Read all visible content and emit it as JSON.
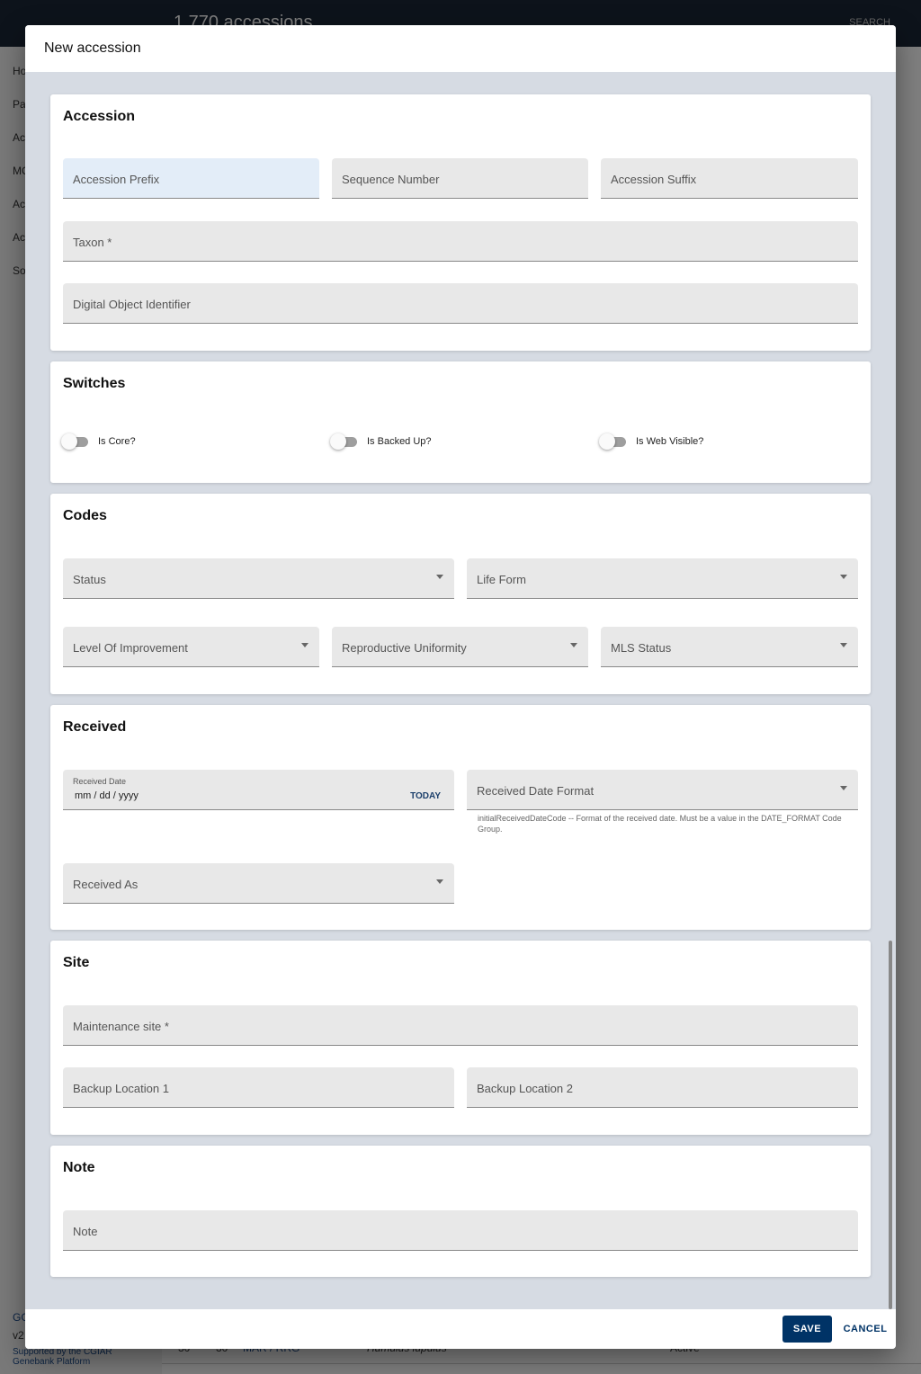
{
  "background": {
    "title": "1,770 accessions",
    "search_label": "SEARCH",
    "sidebar_items": [
      "Ho",
      "Pa",
      "Ac",
      "MC",
      "Ac",
      "Ac",
      "So"
    ],
    "footer": {
      "link1": "GG",
      "version": "v2",
      "supported": "Supported by the CGIAR Genebank Platform"
    },
    "table_row": [
      "30",
      "30",
      "MAR / RRG",
      "Humulus lupulus",
      "Active"
    ]
  },
  "modal": {
    "title": "New accession",
    "sections": {
      "accession": {
        "title": "Accession",
        "prefix": "Accession Prefix",
        "sequence": "Sequence Number",
        "suffix": "Accession Suffix",
        "taxon": "Taxon *",
        "doi": "Digital Object Identifier"
      },
      "switches": {
        "title": "Switches",
        "is_core": "Is Core?",
        "is_backed_up": "Is Backed Up?",
        "is_web_visible": "Is Web Visible?"
      },
      "codes": {
        "title": "Codes",
        "status": "Status",
        "life_form": "Life Form",
        "level_of_improvement": "Level Of Improvement",
        "reproductive_uniformity": "Reproductive Uniformity",
        "mls_status": "MLS Status"
      },
      "received": {
        "title": "Received",
        "date_label": "Received Date",
        "date_placeholder": "mm / dd / yyyy",
        "today": "TODAY",
        "date_format": "Received Date Format",
        "date_format_help": "initialReceivedDateCode -- Format of the received date. Must be a value in the DATE_FORMAT Code Group.",
        "received_as": "Received As"
      },
      "site": {
        "title": "Site",
        "maintenance_site": "Maintenance site *",
        "backup1": "Backup Location 1",
        "backup2": "Backup Location 2"
      },
      "note": {
        "title": "Note",
        "note": "Note"
      }
    },
    "save": "SAVE",
    "cancel": "CANCEL"
  }
}
